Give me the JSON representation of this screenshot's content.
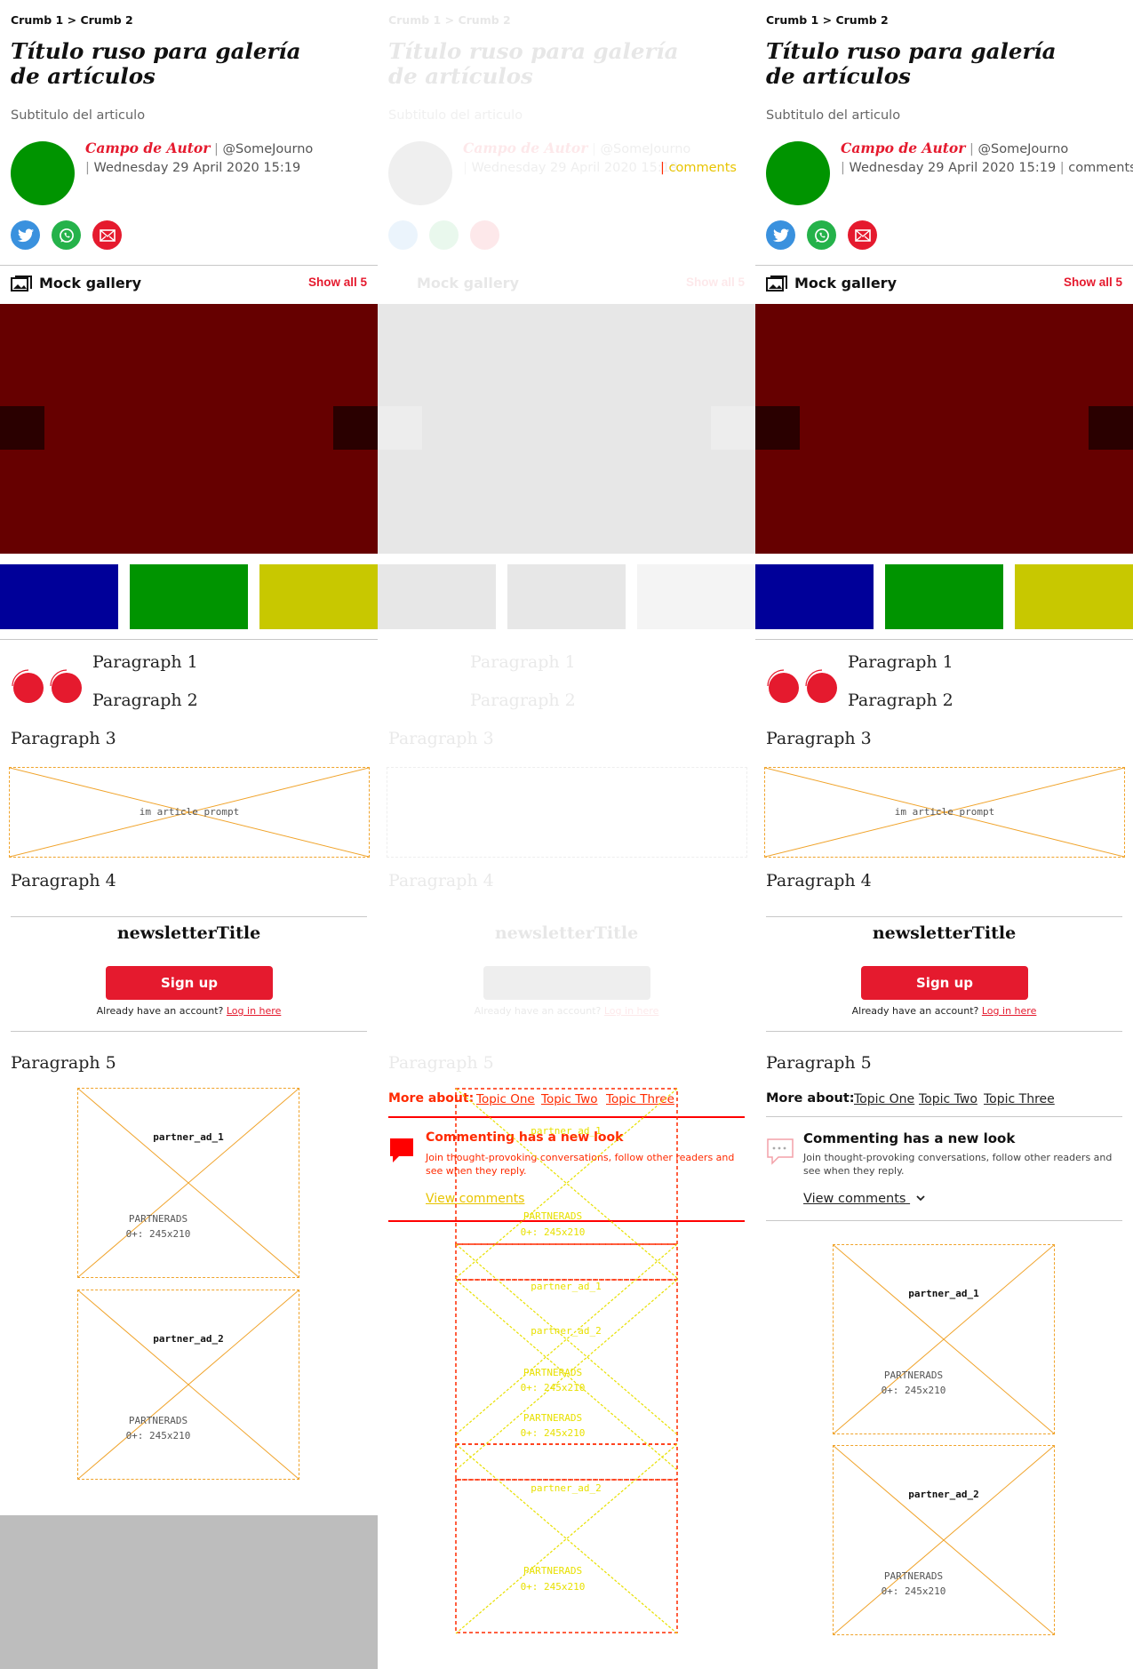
{
  "breadcrumb": {
    "crumb1": "Crumb 1",
    "sep": ">",
    "crumb2": "Crumb 2"
  },
  "article": {
    "title": "Título ruso para galería de artículos",
    "subtitle": "Subtitulo del articulo",
    "author_name": "Campo de Autor",
    "author_handle": "@SomeJourno",
    "date": "Wednesday 29 April 2020 15:19",
    "comments_label": "comments",
    "paragraphs": [
      "Paragraph 1",
      "Paragraph 2",
      "Paragraph 3",
      "Paragraph 4",
      "Paragraph 5"
    ]
  },
  "share": {
    "icons": [
      "twitter-icon",
      "whatsapp-icon",
      "email-icon"
    ]
  },
  "gallery": {
    "title": "Mock gallery",
    "show_all": "Show all 5",
    "hero_color": "#660000",
    "thumb_colors": [
      "#000099",
      "#009400",
      "#c8c800"
    ]
  },
  "in_article_prompt": "im article prompt",
  "newsletter": {
    "title": "newsletterTitle",
    "signup_label": "Sign up",
    "login_prefix": "Already have an account?",
    "login_link": "Log in here"
  },
  "more_about": {
    "label": "More about:",
    "topics": [
      "Topic One",
      "Topic Two",
      "Topic Three"
    ]
  },
  "commenting": {
    "title": "Commenting has a new look",
    "body": "Join thought-provoking conversations, follow other readers and see when they reply.",
    "link": "View comments"
  },
  "ads": [
    {
      "name": "partner_ad_1",
      "provider": "PARTNERADS",
      "size": "0+: 245x210"
    },
    {
      "name": "partner_ad_2",
      "provider": "PARTNERADS",
      "size": "0+: 245x210"
    }
  ],
  "colors": {
    "accent": "#e51a2e",
    "placeholder_border": "#f0a32a",
    "overlay_red": "#ff0000",
    "bottom_gray": "#bdbdbd"
  }
}
